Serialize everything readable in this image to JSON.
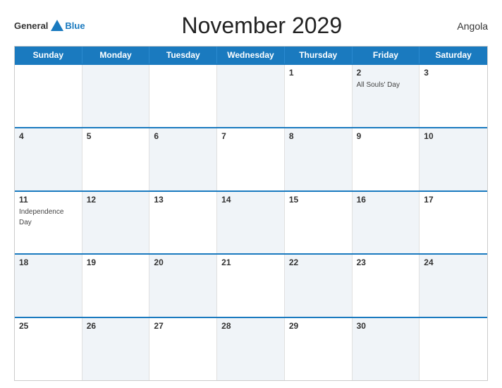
{
  "header": {
    "logo_general": "General",
    "logo_blue": "Blue",
    "title": "November 2029",
    "country": "Angola"
  },
  "days_of_week": [
    "Sunday",
    "Monday",
    "Tuesday",
    "Wednesday",
    "Thursday",
    "Friday",
    "Saturday"
  ],
  "weeks": [
    [
      {
        "day": "",
        "holiday": "",
        "shaded": false
      },
      {
        "day": "",
        "holiday": "",
        "shaded": true
      },
      {
        "day": "",
        "holiday": "",
        "shaded": false
      },
      {
        "day": "",
        "holiday": "",
        "shaded": true
      },
      {
        "day": "1",
        "holiday": "",
        "shaded": false
      },
      {
        "day": "2",
        "holiday": "All Souls' Day",
        "shaded": true
      },
      {
        "day": "3",
        "holiday": "",
        "shaded": false
      }
    ],
    [
      {
        "day": "4",
        "holiday": "",
        "shaded": true
      },
      {
        "day": "5",
        "holiday": "",
        "shaded": false
      },
      {
        "day": "6",
        "holiday": "",
        "shaded": true
      },
      {
        "day": "7",
        "holiday": "",
        "shaded": false
      },
      {
        "day": "8",
        "holiday": "",
        "shaded": true
      },
      {
        "day": "9",
        "holiday": "",
        "shaded": false
      },
      {
        "day": "10",
        "holiday": "",
        "shaded": true
      }
    ],
    [
      {
        "day": "11",
        "holiday": "Independence Day",
        "shaded": false
      },
      {
        "day": "12",
        "holiday": "",
        "shaded": true
      },
      {
        "day": "13",
        "holiday": "",
        "shaded": false
      },
      {
        "day": "14",
        "holiday": "",
        "shaded": true
      },
      {
        "day": "15",
        "holiday": "",
        "shaded": false
      },
      {
        "day": "16",
        "holiday": "",
        "shaded": true
      },
      {
        "day": "17",
        "holiday": "",
        "shaded": false
      }
    ],
    [
      {
        "day": "18",
        "holiday": "",
        "shaded": true
      },
      {
        "day": "19",
        "holiday": "",
        "shaded": false
      },
      {
        "day": "20",
        "holiday": "",
        "shaded": true
      },
      {
        "day": "21",
        "holiday": "",
        "shaded": false
      },
      {
        "day": "22",
        "holiday": "",
        "shaded": true
      },
      {
        "day": "23",
        "holiday": "",
        "shaded": false
      },
      {
        "day": "24",
        "holiday": "",
        "shaded": true
      }
    ],
    [
      {
        "day": "25",
        "holiday": "",
        "shaded": false
      },
      {
        "day": "26",
        "holiday": "",
        "shaded": true
      },
      {
        "day": "27",
        "holiday": "",
        "shaded": false
      },
      {
        "day": "28",
        "holiday": "",
        "shaded": true
      },
      {
        "day": "29",
        "holiday": "",
        "shaded": false
      },
      {
        "day": "30",
        "holiday": "",
        "shaded": true
      },
      {
        "day": "",
        "holiday": "",
        "shaded": false
      }
    ]
  ],
  "colors": {
    "header_bg": "#1a7abf",
    "accent": "#1a7abf"
  }
}
